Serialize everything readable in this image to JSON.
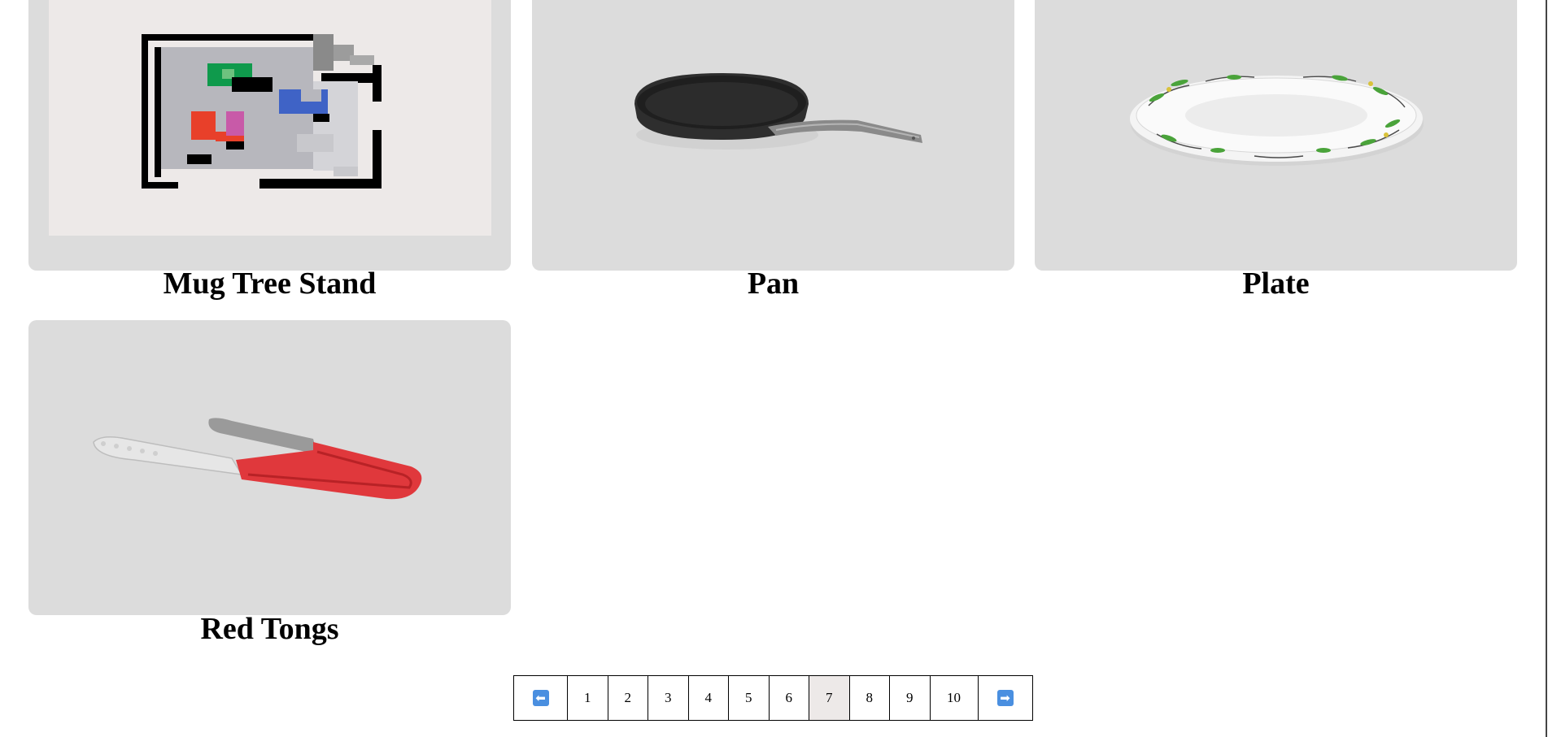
{
  "products": [
    {
      "title": "Mug Tree Stand",
      "image_icon": "broken-image-icon"
    },
    {
      "title": "Pan",
      "image_icon": "pan-image"
    },
    {
      "title": "Plate",
      "image_icon": "plate-image"
    },
    {
      "title": "Red Tongs",
      "image_icon": "tongs-image"
    }
  ],
  "pagination": {
    "prev_icon": "arrow-left-icon",
    "next_icon": "arrow-right-icon",
    "pages": [
      "1",
      "2",
      "3",
      "4",
      "5",
      "6",
      "7",
      "8",
      "9",
      "10"
    ],
    "current": "7"
  },
  "colors": {
    "card_bg": "#dcdcdc",
    "active_page_bg": "#ede9e8",
    "arrow_icon": "#4a8fe0",
    "tongs_red": "#e0383c",
    "pan_dark": "#2e2e2e"
  }
}
